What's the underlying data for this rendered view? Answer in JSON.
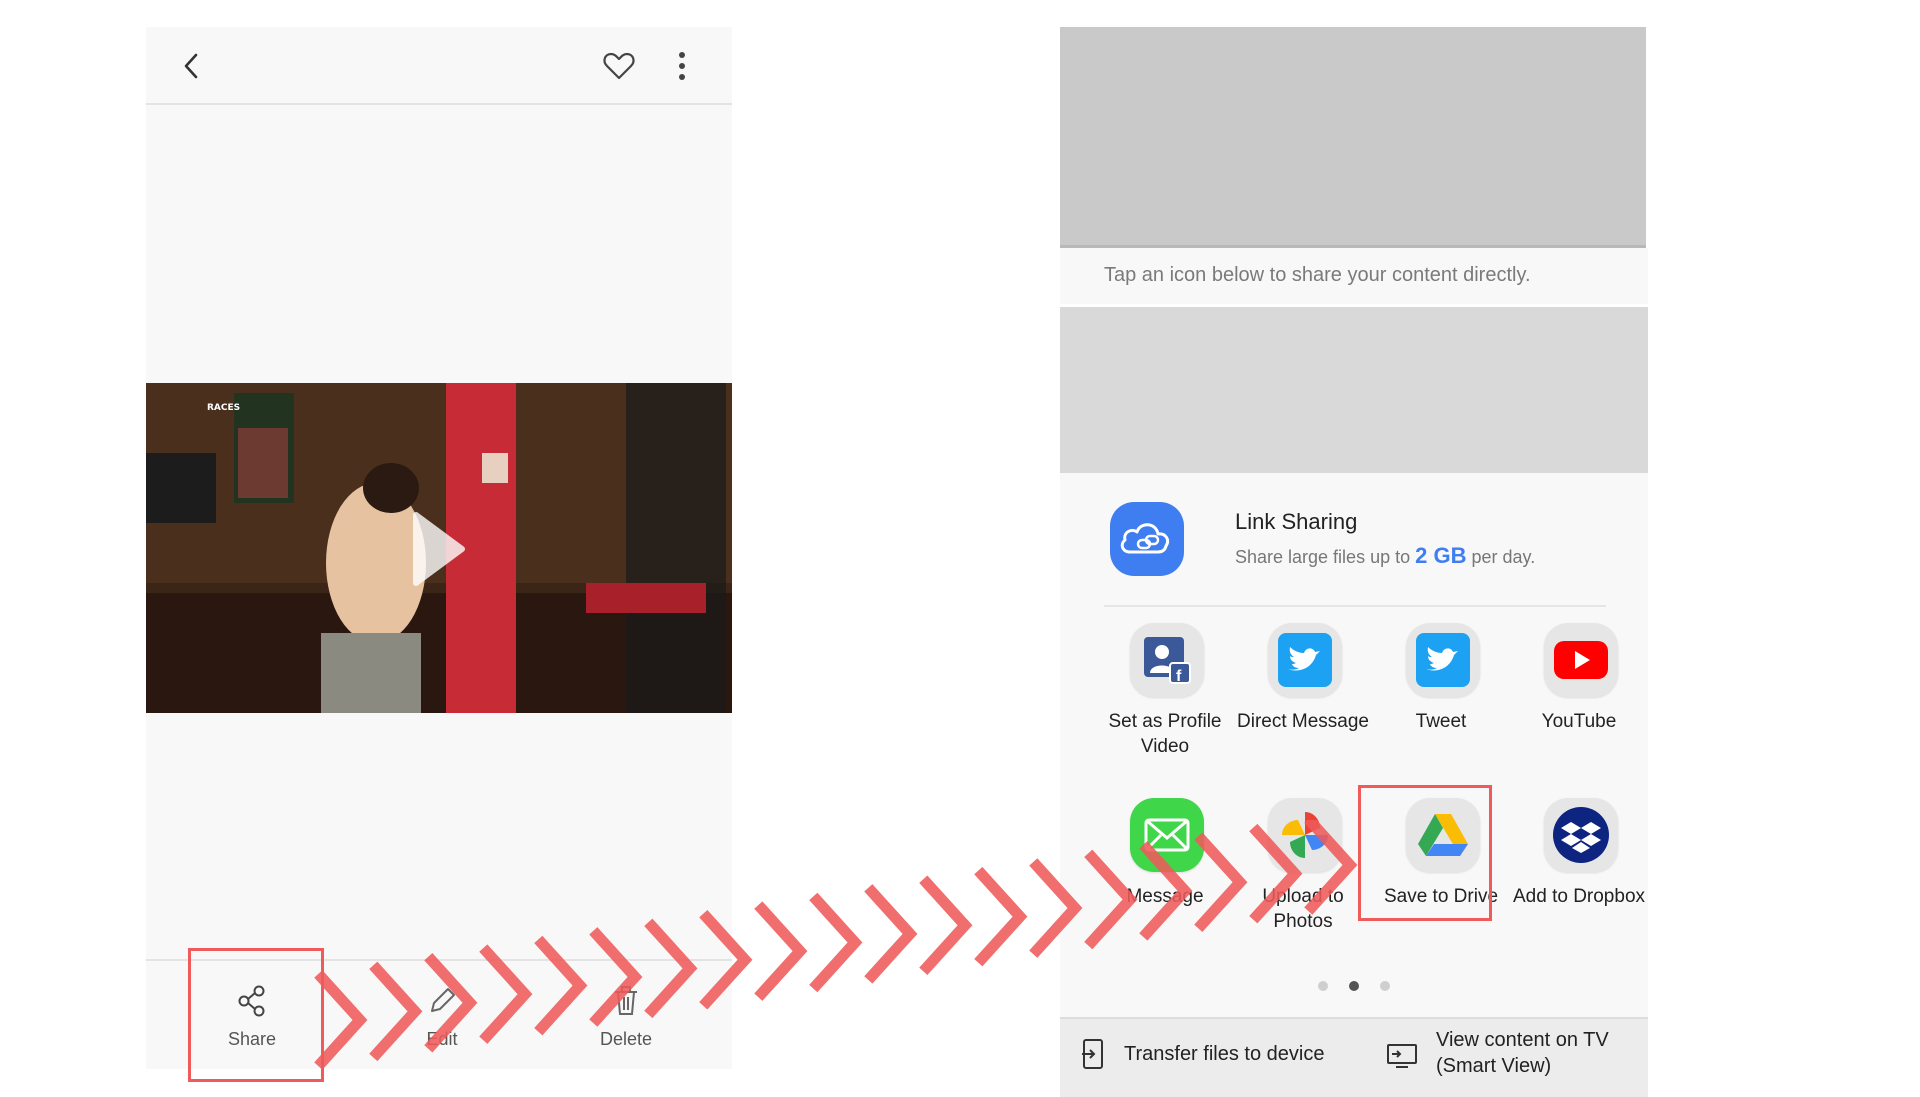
{
  "left_phone": {
    "top_bar": {
      "back_icon": "chevron-left-icon",
      "favorite_icon": "heart-outline-icon",
      "more_icon": "more-vertical-icon"
    },
    "video": {
      "thumbnail_text": "RACES",
      "play_icon": "play-icon"
    },
    "bottom_bar": {
      "share_label": "Share",
      "edit_label": "Edit",
      "delete_label": "Delete"
    }
  },
  "right_phone": {
    "hint": "Tap an icon below to share your content directly.",
    "link_sharing": {
      "title": "Link Sharing",
      "subtitle_prefix": "Share large files up to",
      "subtitle_amount": "2 GB",
      "subtitle_suffix": "per day.",
      "icon": "cloud-link-icon"
    },
    "apps_row1": [
      {
        "label": "Set as Profile Video",
        "icon": "facebook-profile-icon"
      },
      {
        "label": "Direct Message",
        "icon": "twitter-icon"
      },
      {
        "label": "Tweet",
        "icon": "twitter-icon"
      },
      {
        "label": "YouTube",
        "icon": "youtube-icon"
      }
    ],
    "apps_row2": [
      {
        "label": "Message",
        "icon": "messages-icon"
      },
      {
        "label": "Upload to Photos",
        "icon": "google-photos-icon"
      },
      {
        "label": "Save to Drive",
        "icon": "google-drive-icon"
      },
      {
        "label": "Add to Dropbox",
        "icon": "dropbox-icon"
      }
    ],
    "page_indicator": {
      "pages": 3,
      "active_index": 1
    },
    "action_bar": {
      "transfer_label": "Transfer files to device",
      "smart_view_line1": "View content on TV",
      "smart_view_line2": "(Smart View)"
    }
  },
  "colors": {
    "highlight": "#ef5a5a",
    "accent_blue": "#3f7ef0",
    "youtube_red": "#ff0000",
    "twitter_blue": "#1da1f2"
  }
}
